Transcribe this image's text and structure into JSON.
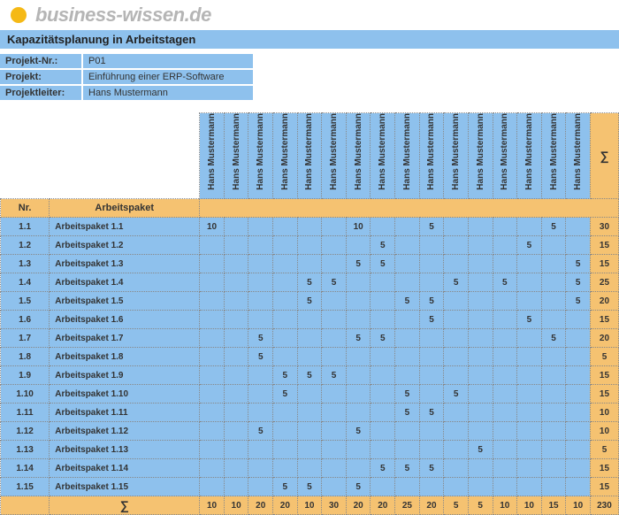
{
  "logo_text": "business-wissen.de",
  "title": "Kapazitätsplanung in Arbeitstagen",
  "meta": {
    "projekt_nr_label": "Projekt-Nr.:",
    "projekt_nr": "P01",
    "projekt_label": "Projekt:",
    "projekt": "Einführung einer ERP-Software",
    "leiter_label": "Projektleiter:",
    "leiter": "Hans Mustermann"
  },
  "columns": {
    "nr": "Nr.",
    "ap": "Arbeitspaket",
    "sum": "∑"
  },
  "people": [
    "Hans Mustermann",
    "Hans Mustermann",
    "Hans Mustermann",
    "Hans Mustermann",
    "Hans Mustermann",
    "Hans Mustermann",
    "Hans Mustermann",
    "Hans Mustermann",
    "Hans Mustermann",
    "Hans Mustermann",
    "Hans Mustermann",
    "Hans Mustermann",
    "Hans Mustermann",
    "Hans Mustermann",
    "Hans Mustermann",
    "Hans Mustermann"
  ],
  "rows": [
    {
      "nr": "1.1",
      "ap": "Arbeitspaket 1.1",
      "v": [
        "10",
        "",
        "",
        "",
        "",
        "",
        "10",
        "",
        "",
        "5",
        "",
        "",
        "",
        "",
        "5",
        ""
      ],
      "sum": "30"
    },
    {
      "nr": "1.2",
      "ap": "Arbeitspaket 1.2",
      "v": [
        "",
        "",
        "",
        "",
        "",
        "",
        "",
        "5",
        "",
        "",
        "",
        "",
        "",
        "5",
        "",
        ""
      ],
      "sum": "15"
    },
    {
      "nr": "1.3",
      "ap": "Arbeitspaket 1.3",
      "v": [
        "",
        "",
        "",
        "",
        "",
        "",
        "5",
        "5",
        "",
        "",
        "",
        "",
        "",
        "",
        "",
        "5"
      ],
      "sum": "15"
    },
    {
      "nr": "1.4",
      "ap": "Arbeitspaket 1.4",
      "v": [
        "",
        "",
        "",
        "",
        "5",
        "5",
        "",
        "",
        "",
        "",
        "5",
        "",
        "5",
        "",
        "",
        "5"
      ],
      "sum": "25"
    },
    {
      "nr": "1.5",
      "ap": "Arbeitspaket 1.5",
      "v": [
        "",
        "",
        "",
        "",
        "5",
        "",
        "",
        "",
        "5",
        "5",
        "",
        "",
        "",
        "",
        "",
        "5"
      ],
      "sum": "20"
    },
    {
      "nr": "1.6",
      "ap": "Arbeitspaket 1.6",
      "v": [
        "",
        "",
        "",
        "",
        "",
        "",
        "",
        "",
        "",
        "5",
        "",
        "",
        "",
        "5",
        "",
        ""
      ],
      "sum": "15"
    },
    {
      "nr": "1.7",
      "ap": "Arbeitspaket 1.7",
      "v": [
        "",
        "",
        "5",
        "",
        "",
        "",
        "5",
        "5",
        "",
        "",
        "",
        "",
        "",
        "",
        "5",
        ""
      ],
      "sum": "20"
    },
    {
      "nr": "1.8",
      "ap": "Arbeitspaket 1.8",
      "v": [
        "",
        "",
        "5",
        "",
        "",
        "",
        "",
        "",
        "",
        "",
        "",
        "",
        "",
        "",
        "",
        ""
      ],
      "sum": "5"
    },
    {
      "nr": "1.9",
      "ap": "Arbeitspaket 1.9",
      "v": [
        "",
        "",
        "",
        "5",
        "5",
        "5",
        "",
        "",
        "",
        "",
        "",
        "",
        "",
        "",
        "",
        ""
      ],
      "sum": "15"
    },
    {
      "nr": "1.10",
      "ap": "Arbeitspaket 1.10",
      "v": [
        "",
        "",
        "",
        "5",
        "",
        "",
        "",
        "",
        "5",
        "",
        "5",
        "",
        "",
        "",
        "",
        ""
      ],
      "sum": "15"
    },
    {
      "nr": "1.11",
      "ap": "Arbeitspaket 1.11",
      "v": [
        "",
        "",
        "",
        "",
        "",
        "",
        "",
        "",
        "5",
        "5",
        "",
        "",
        "",
        "",
        "",
        ""
      ],
      "sum": "10"
    },
    {
      "nr": "1.12",
      "ap": "Arbeitspaket 1.12",
      "v": [
        "",
        "",
        "5",
        "",
        "",
        "",
        "5",
        "",
        "",
        "",
        "",
        "",
        "",
        "",
        "",
        ""
      ],
      "sum": "10"
    },
    {
      "nr": "1.13",
      "ap": "Arbeitspaket 1.13",
      "v": [
        "",
        "",
        "",
        "",
        "",
        "",
        "",
        "",
        "",
        "",
        "",
        "5",
        "",
        "",
        "",
        ""
      ],
      "sum": "5"
    },
    {
      "nr": "1.14",
      "ap": "Arbeitspaket 1.14",
      "v": [
        "",
        "",
        "",
        "",
        "",
        "",
        "",
        "5",
        "5",
        "5",
        "",
        "",
        "",
        "",
        "",
        ""
      ],
      "sum": "15"
    },
    {
      "nr": "1.15",
      "ap": "Arbeitspaket 1.15",
      "v": [
        "",
        "",
        "",
        "5",
        "5",
        "",
        "5",
        "",
        "",
        "",
        "",
        "",
        "",
        "",
        "",
        ""
      ],
      "sum": "15"
    }
  ],
  "totals": {
    "label": "∑",
    "v": [
      "10",
      "10",
      "20",
      "20",
      "10",
      "30",
      "20",
      "20",
      "25",
      "20",
      "5",
      "5",
      "10",
      "10",
      "15"
    ],
    "sum": "230",
    "extra": "10"
  }
}
